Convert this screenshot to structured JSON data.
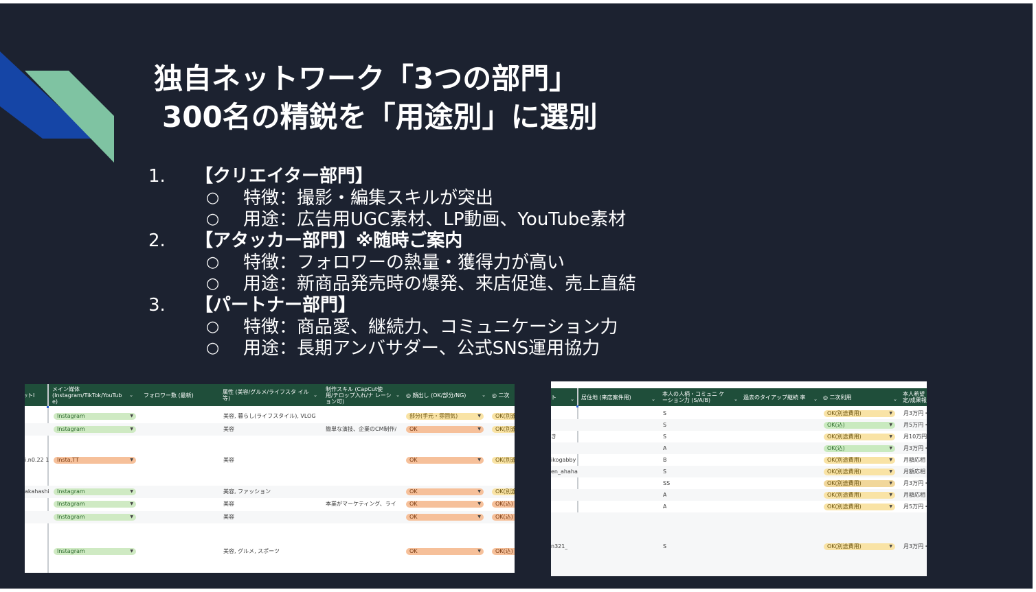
{
  "slide": {
    "title_line1": "独自ネットワーク「3つの部門」",
    "title_line2": "300名の精鋭を「用途別」に選別",
    "sections": [
      {
        "number": "1.",
        "heading": "【クリエイター部門】",
        "bullets": [
          "特徴：撮影・編集スキルが突出",
          "用途：広告用UGC素材、LP動画、YouTube素材"
        ]
      },
      {
        "number": "2.",
        "heading": "【アタッカー部門】※随時ご案内",
        "bullets": [
          "特徴：フォロワーの熱量・獲得力が高い",
          "用途：新商品発売時の爆発、来店促進、売上直結"
        ]
      },
      {
        "number": "3.",
        "heading": "【パートナー部門】",
        "bullets": [
          "特徴：商品愛、継続力、コミュニケーション力",
          "用途：長期アンバサダー、公式SNS運用協力"
        ]
      }
    ],
    "bullet_glyph": "○",
    "colors": {
      "background": "#1c2230",
      "deco_blue": "#1545a6",
      "deco_green": "#7fc3a2",
      "text": "#ffffff"
    }
  },
  "sheet_left": {
    "headers": [
      "ｯトI",
      "メイン媒体 (Instagram/TikTok/YouTub e)",
      "フォロワー数 (最新)",
      "属性 (美容/グルメ/ライフスタ イル等)",
      "制作スキル (CapCut使 用/テロップ入れ/ナ レーション可)",
      "◎ 顔出し (OK/部分/NG)",
      "◎ 二次"
    ],
    "dropdown_glyph": "⌄",
    "rows": [
      {
        "id": "",
        "media": "Instagram",
        "attr": "美容, 暮らし(ライフスタイル), VLOG",
        "skill": "",
        "face": "部分(手元・雰囲気)",
        "second": "OK(別途"
      },
      {
        "id": "",
        "media": "Instagram",
        "attr": "美容",
        "skill": "簡単な演技、企業のCM制作/",
        "face": "OK",
        "second": "OK(別途"
      },
      {
        "id": "i.n0.22 1",
        "media": "Insta,TT",
        "attr": "美容",
        "skill": "",
        "face": "OK",
        "second": "OK(別途"
      },
      {
        "id": "akahashi",
        "media": "Instagram",
        "attr": "美容, ファッション",
        "skill": "",
        "face": "OK",
        "second": "OK(別途"
      },
      {
        "id": "",
        "media": "Instagram",
        "attr": "美容",
        "skill": "本業がマーケティング、ライ",
        "face": "OK",
        "second": "OK(込)"
      },
      {
        "id": "",
        "media": "Instagram",
        "attr": "美容",
        "skill": "",
        "face": "OK",
        "second": "OK(込)"
      },
      {
        "id": "",
        "media": "Instagram",
        "attr": "美容, グルメ, スポーツ",
        "skill": "",
        "face": "OK",
        "second": "OK(込)"
      }
    ]
  },
  "sheet_right": {
    "headers": [
      "ト",
      "居住地 (来店案件用)",
      "本人の人柄・コミュニ ケーション力 (S/A/B)",
      "過去のタイアップ継続 率",
      "◎ 二次利用",
      "本人希望 定/成果報"
    ],
    "rows": [
      {
        "id": "",
        "rank": "S",
        "secondary": "OK(別途費用)",
        "fee": "月3万円・"
      },
      {
        "id": "",
        "rank": "S",
        "secondary": "OK(込)",
        "fee": "月5万円・"
      },
      {
        "id": "き",
        "rank": "S",
        "secondary": "OK(別途費用)",
        "fee": "月10万円"
      },
      {
        "id": "",
        "rank": "A",
        "secondary": "OK(込)",
        "fee": "月3万円・"
      },
      {
        "id": "ikogabby",
        "rank": "B",
        "secondary": "OK(別途費用)",
        "fee": "月額応相"
      },
      {
        "id": "en_ahaha",
        "rank": "S",
        "secondary": "OK(別途費用)",
        "fee": "月額応相"
      },
      {
        "id": "",
        "rank": "SS",
        "secondary": "OK(別途費用)",
        "fee": "月3万円・"
      },
      {
        "id": "",
        "rank": "A",
        "secondary": "OK(別途費用)",
        "fee": "月額応相"
      },
      {
        "id": "",
        "rank": "A",
        "secondary": "OK(別途費用)",
        "fee": "月5万円・"
      },
      {
        "id": "n321_",
        "rank": "S",
        "secondary": "OK(別途費用)",
        "fee": "月3万円・"
      }
    ]
  }
}
